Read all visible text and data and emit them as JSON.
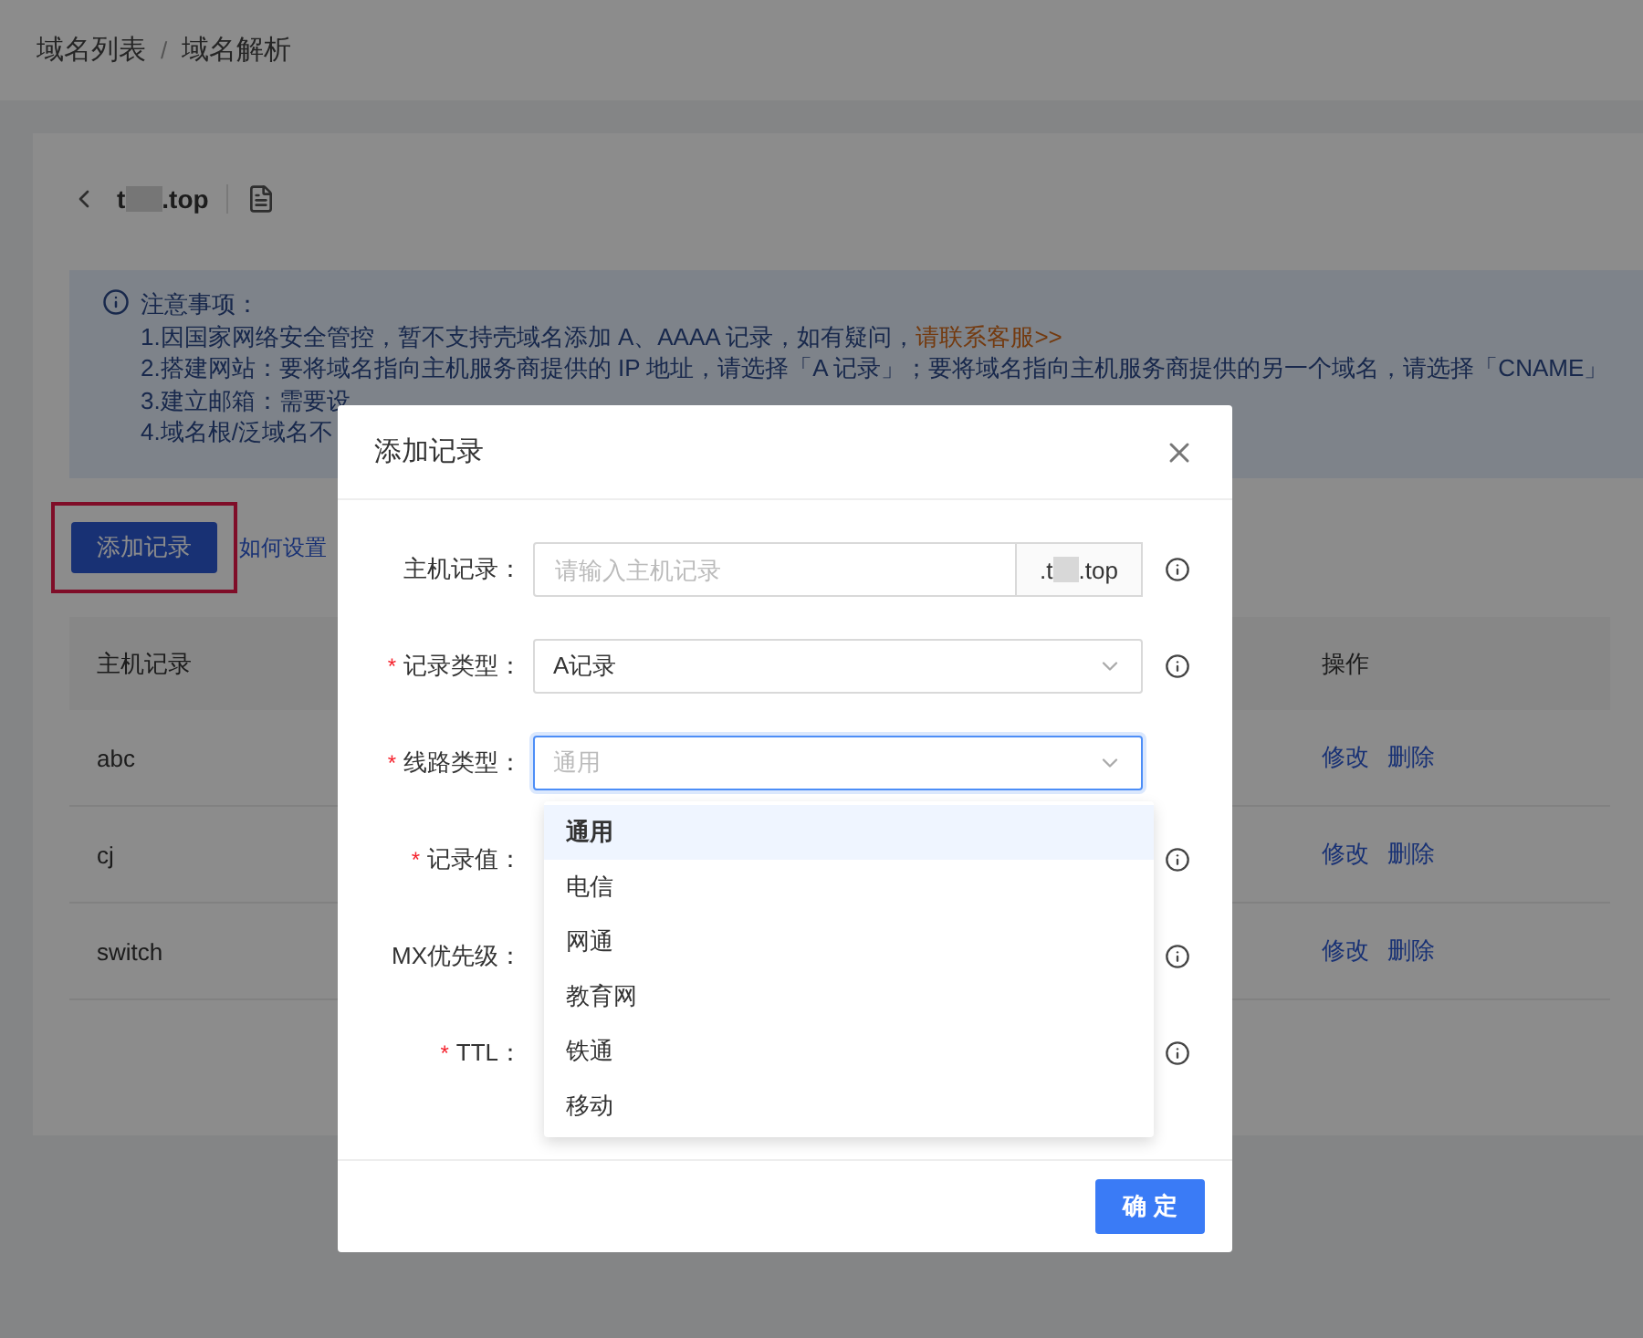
{
  "breadcrumb": {
    "items": [
      "域名列表",
      "域名解析"
    ],
    "separator": "/"
  },
  "domain": {
    "prefix": "t",
    "suffix": ".top"
  },
  "notice": {
    "title": "注意事项：",
    "lines": [
      {
        "text": "1.因国家网络安全管控，暂不支持壳域名添加 A、AAAA 记录，如有疑问，",
        "link": "请联系客服>>"
      },
      {
        "text": "2.搭建网站：要将域名指向主机服务商提供的 IP 地址，请选择「A 记录」；要将域名指向主机服务商提供的另一个域名，请选择「CNAME」"
      },
      {
        "text": "3.建立邮箱：需要设"
      },
      {
        "text": "4.域名根/泛域名不"
      }
    ]
  },
  "add_button": {
    "label": "添加记录",
    "highlighted": true
  },
  "help_link": "如何设置",
  "table": {
    "columns": [
      "主机记录",
      "操作"
    ],
    "rows": [
      {
        "host": "abc",
        "actions": [
          "修改",
          "删除"
        ]
      },
      {
        "host": "cj",
        "actions": [
          "修改",
          "删除"
        ]
      },
      {
        "host": "switch",
        "actions": [
          "修改",
          "删除"
        ]
      }
    ]
  },
  "dialog": {
    "title": "添加记录",
    "required_mark": "*",
    "fields": [
      {
        "kind": "input",
        "label": "主机记录：",
        "required": false,
        "placeholder": "请输入主机记录",
        "addon_prefix": ".t",
        "addon_suffix": ".top",
        "info": true
      },
      {
        "kind": "select",
        "label": "记录类型：",
        "required": true,
        "value": "A记录",
        "focused": false,
        "info": true
      },
      {
        "kind": "select",
        "label": "线路类型：",
        "required": true,
        "placeholder": "通用",
        "focused": true,
        "info": false
      },
      {
        "kind": "covered",
        "label": "记录值：",
        "required": true,
        "info": true
      },
      {
        "kind": "covered",
        "label": "MX优先级：",
        "required": false,
        "info": true
      },
      {
        "kind": "covered",
        "label": "TTL：",
        "required": true,
        "info": true
      }
    ],
    "dropdown": [
      {
        "label": "通用",
        "selected": true
      },
      {
        "label": "电信",
        "selected": false
      },
      {
        "label": "网通",
        "selected": false
      },
      {
        "label": "教育网",
        "selected": false
      },
      {
        "label": "铁通",
        "selected": false
      },
      {
        "label": "移动",
        "selected": false
      }
    ],
    "ok_button": "确 定"
  }
}
